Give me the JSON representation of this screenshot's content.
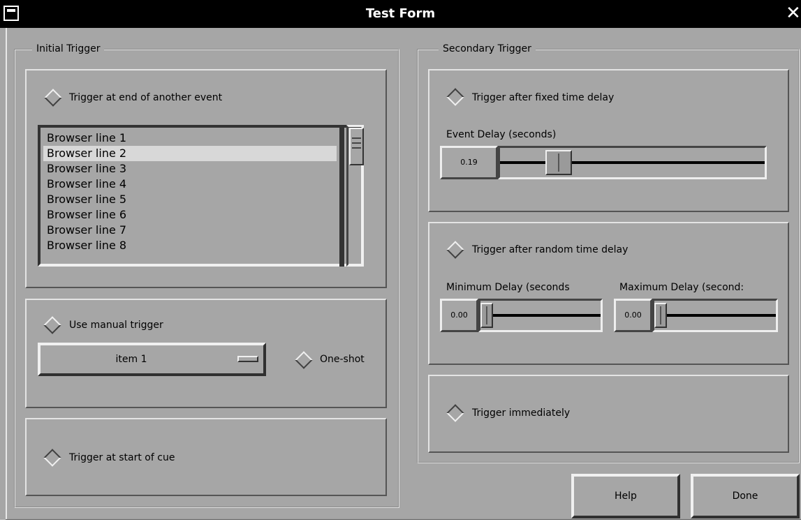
{
  "window": {
    "title": "Test Form",
    "close_glyph": "✕"
  },
  "initial_trigger": {
    "group_label": "Initial Trigger",
    "end_event": {
      "label": "Trigger at end of another event",
      "selected": false
    },
    "browser": {
      "lines": [
        "Browser line 1",
        "Browser line 2",
        "Browser line 3",
        "Browser line 4",
        "Browser line 5",
        "Browser line 6",
        "Browser line 7",
        "Browser line 8"
      ],
      "selected_index": 1
    },
    "manual": {
      "label": "Use manual trigger",
      "selected": false,
      "choice_value": "item 1",
      "one_shot_label": "One-shot",
      "one_shot_checked": false
    },
    "start_cue": {
      "label": "Trigger at start of cue",
      "selected": true
    }
  },
  "secondary_trigger": {
    "group_label": "Secondary Trigger",
    "fixed": {
      "label": "Trigger after fixed time delay",
      "selected": true,
      "slider_label": "Event Delay (seconds)",
      "value": "0.19",
      "fraction": 0.19
    },
    "random": {
      "label": "Trigger after random time delay",
      "selected": false,
      "min_label": "Minimum Delay (seconds",
      "min_value": "0.00",
      "min_fraction": 0,
      "max_label": "Maximum Delay (second:",
      "max_value": "0.00",
      "max_fraction": 0
    },
    "immediate": {
      "label": "Trigger immediately",
      "selected": true
    }
  },
  "buttons": {
    "help": "Help",
    "done": "Done"
  }
}
